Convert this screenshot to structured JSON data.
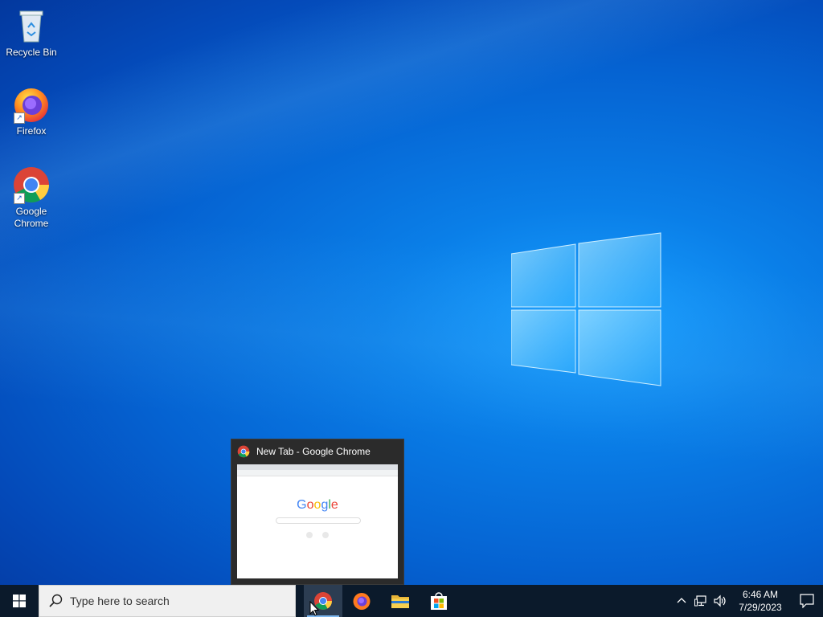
{
  "desktop": {
    "icons": [
      {
        "label": "Recycle Bin",
        "icon": "recycle-bin-icon"
      },
      {
        "label": "Firefox",
        "icon": "firefox-icon"
      },
      {
        "label": "Google Chrome",
        "icon": "chrome-icon"
      }
    ]
  },
  "preview": {
    "title": "New Tab - Google Chrome",
    "logo_text": "Google"
  },
  "taskbar": {
    "search_placeholder": "Type here to search",
    "apps": [
      {
        "name": "Google Chrome",
        "icon": "chrome-icon",
        "active": true
      },
      {
        "name": "Firefox",
        "icon": "firefox-icon",
        "active": false
      },
      {
        "name": "File Explorer",
        "icon": "folder-icon",
        "active": false
      },
      {
        "name": "Microsoft Store",
        "icon": "store-icon",
        "active": false
      }
    ],
    "clock": {
      "time": "6:46 AM",
      "date": "7/29/2023"
    }
  },
  "colors": {
    "taskbar_bg": "#0b1a2b",
    "accent": "#0a7fe8",
    "active_indicator": "#7db7ee"
  }
}
